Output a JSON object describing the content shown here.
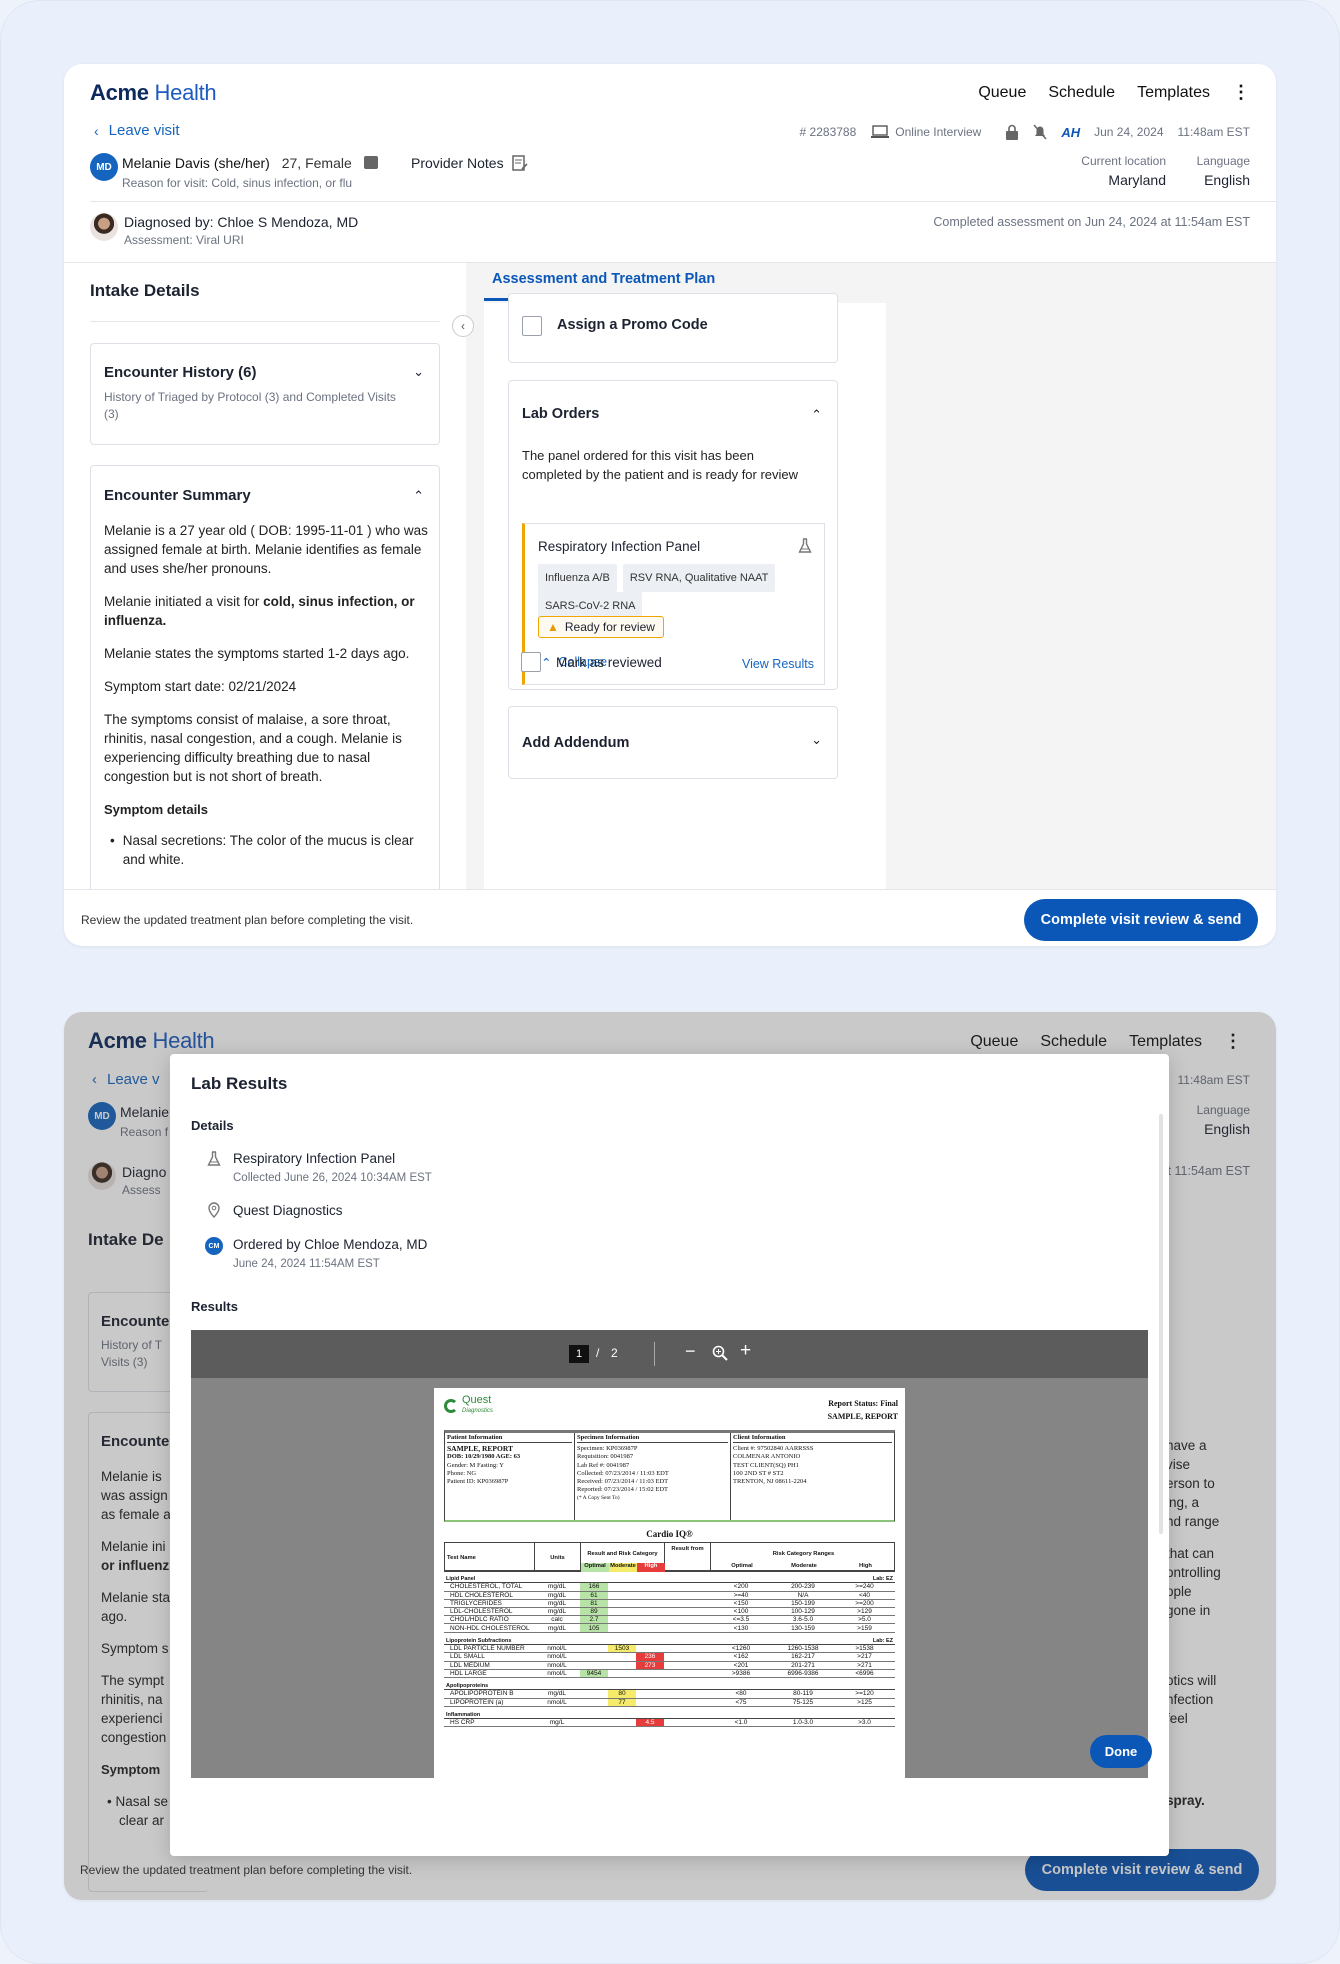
{
  "brand": {
    "name_bold": "Acme",
    "name_light": " Health"
  },
  "nav": [
    "Queue",
    "Schedule",
    "Templates"
  ],
  "leave": "Leave visit",
  "leave_partial": "Leave v",
  "case_no": "# 2283788",
  "interview": "Online Interview",
  "ah": "AH",
  "date": "Jun 24, 2024",
  "time": "11:48am EST",
  "patient": {
    "initials": "MD",
    "name": "Melanie Davis (she/her)",
    "age": "27,",
    "sex": "Female",
    "reason": "Reason for visit: Cold, sinus infection, or flu",
    "name_partial": "Melanie",
    "reason_partial": "Reason f"
  },
  "provider_notes": "Provider Notes",
  "location": {
    "label": "Current location",
    "value": "Maryland"
  },
  "language": {
    "label": "Language",
    "value": "English"
  },
  "diagnosed": {
    "title": "Diagnosed by: Chloe S Mendoza, MD",
    "assessment": "Assessment: Viral URI",
    "completed": "Completed assessment on Jun 24, 2024 at 11:54am EST",
    "title_partial": "Diagno",
    "assessment_partial": "Assess",
    "completed_partial": "t 11:54am EST"
  },
  "intake": {
    "title": "Intake Details",
    "title_partial": "Intake De",
    "history": {
      "title": "Encounter History (6)",
      "sub": "History of Triaged by Protocol (3) and Completed Visits (3)",
      "title_partial": "Encounte",
      "sub_partial1": "History of T",
      "sub_partial2": "Visits (3)"
    },
    "summary": {
      "title": "Encounter Summary",
      "title_partial": "Encounte",
      "p1": "Melanie is a 27 year old ( DOB: 1995-11-01 ) who was assigned female at birth. Melanie identifies as female and uses she/her pronouns.",
      "p2_pre": "Melanie initiated a visit for ",
      "p2_bold": "cold, sinus infection, or influenza.",
      "p3": "Melanie states the symptoms started 1-2 days ago.",
      "p4": "Symptom start date: 02/21/2024",
      "p5": "The symptoms consist of malaise, a sore throat, rhinitis, nasal congestion, and a cough. Melanie is experiencing difficulty breathing due to nasal congestion but is not short of breath.",
      "details_title": "Symptom details",
      "bullet": "Nasal secretions: The color of the mucus is clear and white.",
      "partials": [
        "Melanie is",
        "was assign",
        "as female a",
        "Melanie ini",
        "or influenz",
        "Melanie sta",
        "ago.",
        "Symptom s",
        "The sympt",
        "rhinitis, na",
        "experienci",
        "congestion",
        "Symptom",
        "Nasal se",
        "clear ar"
      ]
    }
  },
  "plan": {
    "tab": "Assessment and Treatment Plan",
    "promo": "Assign a Promo Code",
    "lab": {
      "title": "Lab Orders",
      "desc": "The panel ordered for this visit has been completed by the patient and is ready for review",
      "panel": "Respiratory Infection Panel",
      "tags": [
        "Influenza A/B",
        "RSV RNA, Qualitative NAAT",
        "SARS-CoV-2 RNA"
      ],
      "status": "Ready for review",
      "collapse": "Collapse",
      "view": "View Results",
      "mark": "Mark as reviewed"
    },
    "addendum": "Add Addendum"
  },
  "right_partials": [
    "have a",
    "vise",
    "erson to",
    "ing, a",
    "nd range",
    "that can",
    "ontrolling",
    "ople",
    "gone in",
    "otics will",
    "nfection",
    "feel",
    "spray."
  ],
  "footer": {
    "text": "Review the updated treatment plan before completing the visit.",
    "button": "Complete visit review & send"
  },
  "modal": {
    "title": "Lab Results",
    "details": "Details",
    "panel": "Respiratory Infection Panel",
    "collected": "Collected June 26, 2024 10:34AM EST",
    "lab": "Quest Diagnostics",
    "ordered_initials": "CM",
    "ordered": "Ordered by Chloe Mendoza, MD",
    "ordered_date": "June 24, 2024 11:54AM EST",
    "results": "Results",
    "page": "1",
    "pages": "2",
    "done": "Done"
  },
  "report": {
    "logo": "Quest",
    "logo_sub": "Diagnostics",
    "status": "Report Status: Final",
    "name": "SAMPLE, REPORT",
    "patient_info": "Patient Information",
    "specimen_info": "Specimen Information",
    "client_info": "Client Information",
    "patient_lines": [
      "SAMPLE, REPORT",
      "DOB: 10/29/1980    AGE: 63",
      "Gender:   M    Fasting: Y",
      "Phone:    NG",
      "Patient ID: KP036987P"
    ],
    "specimen_lines": [
      "Specimen:  KP036987P",
      "Requisition:  0041987",
      "Lab Ref #:  0041987",
      "Collected:  07/23/2014 / 11:03 EDT",
      "Received:  07/23/2014 / 11:03 EDT",
      "Reported:  07/23/2014 / 15:02 EDT",
      "(* A Copy Sent To)"
    ],
    "client_lines": [
      "Client #: 97502840     AARRSSS",
      "COLMENAR ANTONIO",
      "TEST CLIENT(SQ) PH1",
      "100 2ND ST # ST2",
      "TRENTON, NJ 08611-2204"
    ],
    "cardio": "Cardio IQ®",
    "h_test": "Test Name",
    "h_units": "Units",
    "h_rrc": "Result and Risk Category",
    "h_from": "Result from",
    "h_ranges": "Risk Category Ranges",
    "h_opt": "Optimal",
    "h_mod": "Moderate",
    "h_high": "High",
    "lab_ez": "Lab: EZ",
    "sections": [
      {
        "name": "Lipid Panel",
        "rows": [
          [
            "CHOLESTEROL, TOTAL",
            "mg/dL",
            "166",
            "g",
            "<200",
            "200-239",
            ">=240"
          ],
          [
            "HDL CHOLESTEROL",
            "mg/dL",
            "61",
            "g",
            ">=40",
            "N/A",
            "<40"
          ],
          [
            "TRIGLYCERIDES",
            "mg/dL",
            "81",
            "g",
            "<150",
            "150-199",
            ">=200"
          ],
          [
            "LDL-CHOLESTEROL",
            "mg/dL",
            "89",
            "g",
            "<100",
            "100-129",
            ">129"
          ],
          [
            "CHOL/HDLC RATIO",
            "calc",
            "2.7",
            "g",
            "<=3.5",
            "3.6-5.0",
            ">5.0"
          ],
          [
            "NON-HDL CHOLESTEROL",
            "mg/dL",
            "105",
            "g",
            "<130",
            "130-159",
            ">159"
          ]
        ]
      },
      {
        "name": "Lipoprotein Subfractions",
        "rows": [
          [
            "LDL PARTICLE NUMBER",
            "nmol/L",
            "1503",
            "y",
            "<1260",
            "1260-1538",
            ">1538"
          ],
          [
            "LDL SMALL",
            "nmol/L",
            "236",
            "r",
            "<162",
            "162-217",
            ">217"
          ],
          [
            "LDL MEDIUM",
            "nmol/L",
            "273",
            "r",
            "<201",
            "201-271",
            ">271"
          ],
          [
            "HDL LARGE",
            "nmol/L",
            "9454",
            "g",
            ">9386",
            "6996-9386",
            "<6996"
          ]
        ]
      },
      {
        "name": "Apolipoproteins",
        "rows": [
          [
            "APOLIPOPROTEIN B",
            "mg/dL",
            "80",
            "y",
            "<80",
            "80-119",
            ">=120"
          ],
          [
            "LIPOPROTEIN (a)",
            "nmol/L",
            "77",
            "y",
            "<75",
            "75-125",
            ">125"
          ]
        ]
      },
      {
        "name": "Inflammation",
        "rows": [
          [
            "HS CRP",
            "mg/L",
            "4.5",
            "r",
            "<1.0",
            "1.0-3.0",
            ">3.0"
          ]
        ]
      }
    ]
  },
  "colors": {
    "primary": "#0b57b8",
    "brand": "#0d2a5e",
    "warning": "#f0a500"
  }
}
